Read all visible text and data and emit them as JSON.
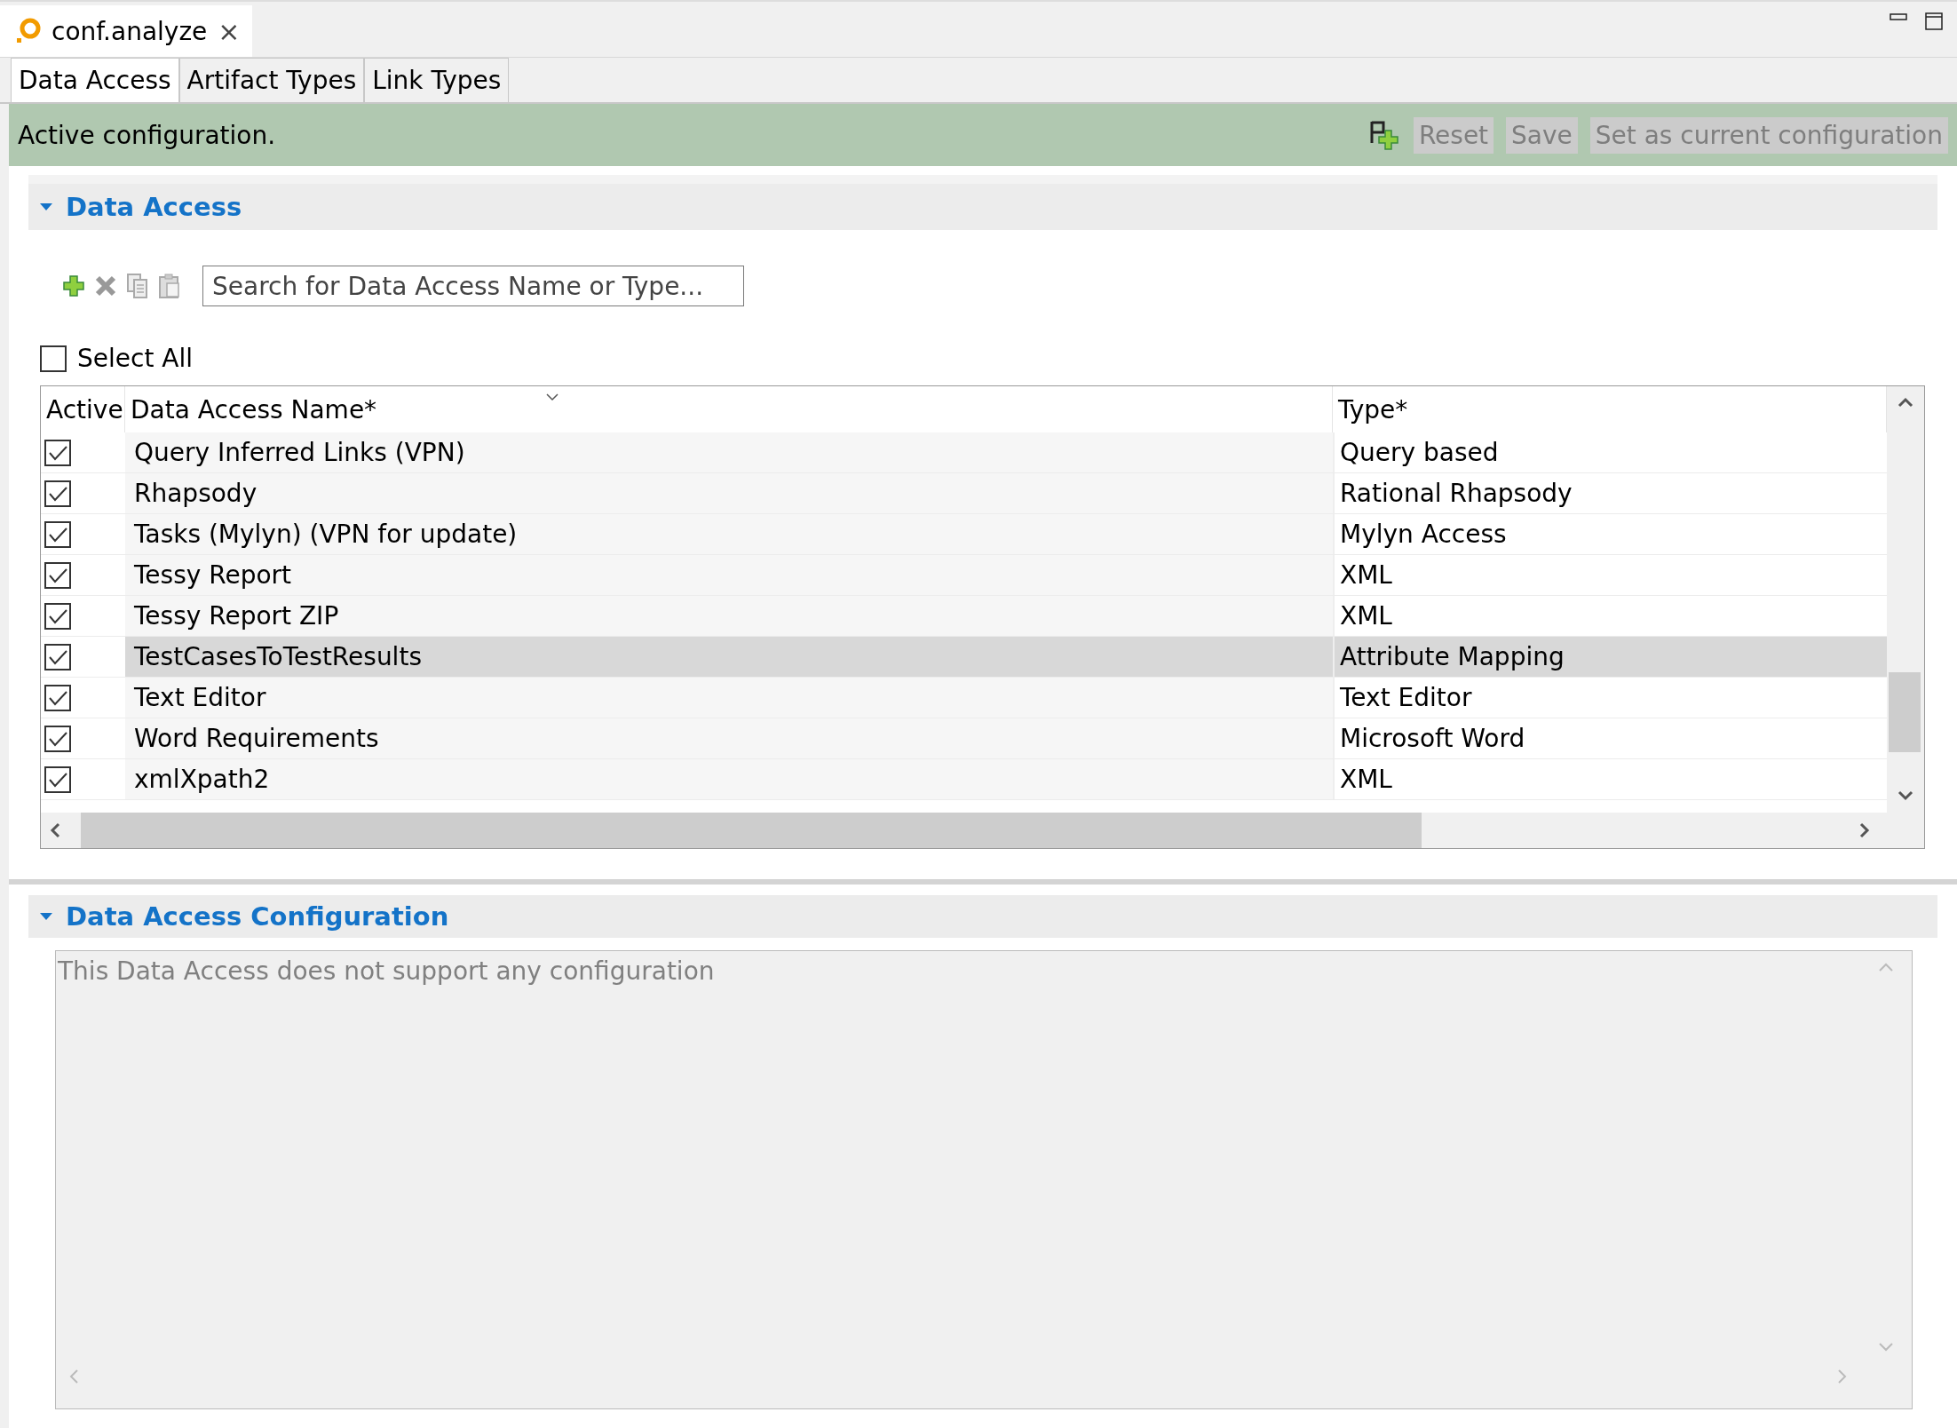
{
  "editor_tab": {
    "title": "conf.analyze",
    "close": "×"
  },
  "tabs": [
    {
      "label": "Data Access",
      "selected": true
    },
    {
      "label": "Artifact Types",
      "selected": false
    },
    {
      "label": "Link Types",
      "selected": false
    }
  ],
  "status": {
    "message": "Active configuration.",
    "buttons": [
      {
        "label": "Reset",
        "disabled": true
      },
      {
        "label": "Save",
        "disabled": true
      },
      {
        "label": "Set as current configuration",
        "disabled": true
      }
    ]
  },
  "data_access": {
    "title": "Data Access",
    "expanded": true,
    "search": {
      "placeholder": "Search for Data Access Name or Type..."
    },
    "select_all": {
      "label": "Select All",
      "checked": false
    },
    "columns": [
      "Active",
      "Data Access Name*",
      "Type*"
    ],
    "rows": [
      {
        "name": "Query Inferred Links (VPN)",
        "type": "Query based",
        "active": true,
        "selected": false
      },
      {
        "name": "Rhapsody",
        "type": "Rational Rhapsody",
        "active": true,
        "selected": false
      },
      {
        "name": "Tasks (Mylyn) (VPN for update)",
        "type": "Mylyn Access",
        "active": true,
        "selected": false
      },
      {
        "name": "Tessy Report",
        "type": "XML",
        "active": true,
        "selected": false
      },
      {
        "name": "Tessy Report ZIP",
        "type": "XML",
        "active": true,
        "selected": false
      },
      {
        "name": "TestCasesToTestResults",
        "type": "Attribute Mapping",
        "active": true,
        "selected": true
      },
      {
        "name": "Text Editor",
        "type": "Text Editor",
        "active": true,
        "selected": false
      },
      {
        "name": "Word Requirements",
        "type": "Microsoft Word",
        "active": true,
        "selected": false
      },
      {
        "name": "xmlXpath2",
        "type": "XML",
        "active": true,
        "selected": false
      }
    ]
  },
  "configuration": {
    "title": "Data Access Configuration",
    "expanded": true,
    "message": "This Data Access does not support any configuration"
  }
}
